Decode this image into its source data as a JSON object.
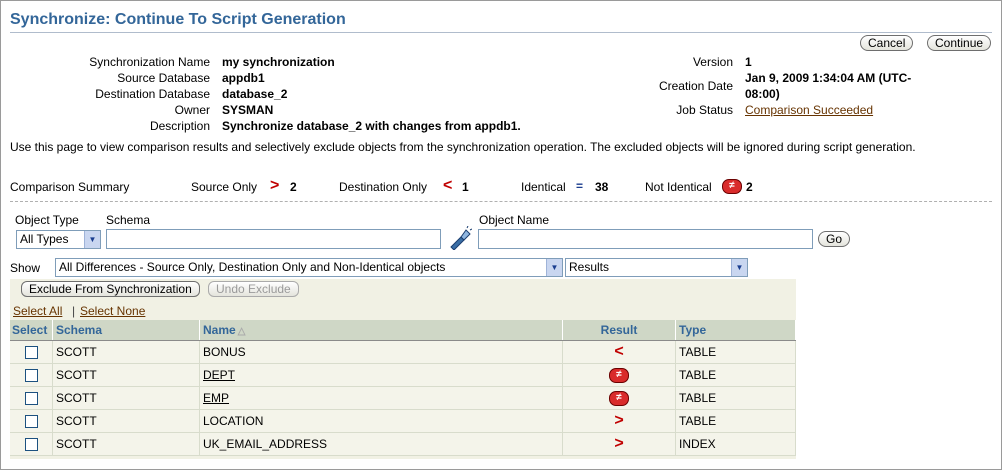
{
  "page": {
    "title": "Synchronize: Continue To Script Generation"
  },
  "actions": {
    "cancel": "Cancel",
    "continue": "Continue"
  },
  "info": {
    "sync_name_label": "Synchronization Name",
    "sync_name": "my synchronization",
    "source_db_label": "Source Database",
    "source_db": "appdb1",
    "dest_db_label": "Destination Database",
    "dest_db": "database_2",
    "owner_label": "Owner",
    "owner": "SYSMAN",
    "description_label": "Description",
    "description": "Synchronize database_2 with changes from appdb1.",
    "version_label": "Version",
    "version": "1",
    "creation_label": "Creation Date",
    "creation_line1": "Jan 9, 2009 1:34:04 AM (UTC-",
    "creation_line2": "08:00)",
    "job_status_label": "Job Status",
    "job_status": "Comparison Succeeded"
  },
  "instructions": "Use this page to view comparison results and selectively exclude objects from the synchronization operation. The excluded objects will be ignored during script generation.",
  "summary": {
    "label": "Comparison Summary",
    "source_only_label": "Source Only",
    "source_only_count": "2",
    "dest_only_label": "Destination Only",
    "dest_only_count": "1",
    "identical_label": "Identical",
    "identical_count": "38",
    "not_identical_label": "Not Identical",
    "not_identical_count": "2"
  },
  "filters": {
    "object_type_label": "Object Type",
    "object_type_value": "All Types",
    "schema_label": "Schema",
    "schema_value": "",
    "object_name_label": "Object Name",
    "object_name_value": "",
    "go": "Go",
    "show_label": "Show",
    "show_value": "All Differences - Source Only, Destination Only and Non-Identical objects",
    "view_value": "Results"
  },
  "table_actions": {
    "exclude": "Exclude From Synchronization",
    "undo": "Undo Exclude",
    "select_all": "Select All",
    "separator": "|",
    "select_none": "Select None"
  },
  "columns": {
    "select": "Select",
    "schema": "Schema",
    "name": "Name",
    "result": "Result",
    "type": "Type"
  },
  "icons": {
    "source_only": "source-only-icon",
    "dest_only": "destination-only-icon",
    "identical": "identical-icon",
    "not_identical": "not-identical-icon",
    "sort": "sort-ascending-icon",
    "flashlight": "flashlight-search-icon"
  },
  "colors": {
    "title": "#336699",
    "header_bg": "#cfd7c6",
    "result_red": "#c00000",
    "link_brown": "#663300"
  },
  "rows": [
    {
      "schema": "SCOTT",
      "name": "BONUS",
      "result_symbol": "<",
      "result_icon": "destination-only-icon",
      "type": "TABLE"
    },
    {
      "schema": "SCOTT",
      "name": "DEPT",
      "result_symbol": "≠",
      "result_icon": "not-identical-icon",
      "type": "TABLE"
    },
    {
      "schema": "SCOTT",
      "name": "EMP",
      "result_symbol": "≠",
      "result_icon": "not-identical-icon",
      "type": "TABLE"
    },
    {
      "schema": "SCOTT",
      "name": "LOCATION",
      "result_symbol": ">",
      "result_icon": "source-only-icon",
      "type": "TABLE"
    },
    {
      "schema": "SCOTT",
      "name": "UK_EMAIL_ADDRESS",
      "result_symbol": ">",
      "result_icon": "source-only-icon",
      "type": "INDEX"
    }
  ]
}
